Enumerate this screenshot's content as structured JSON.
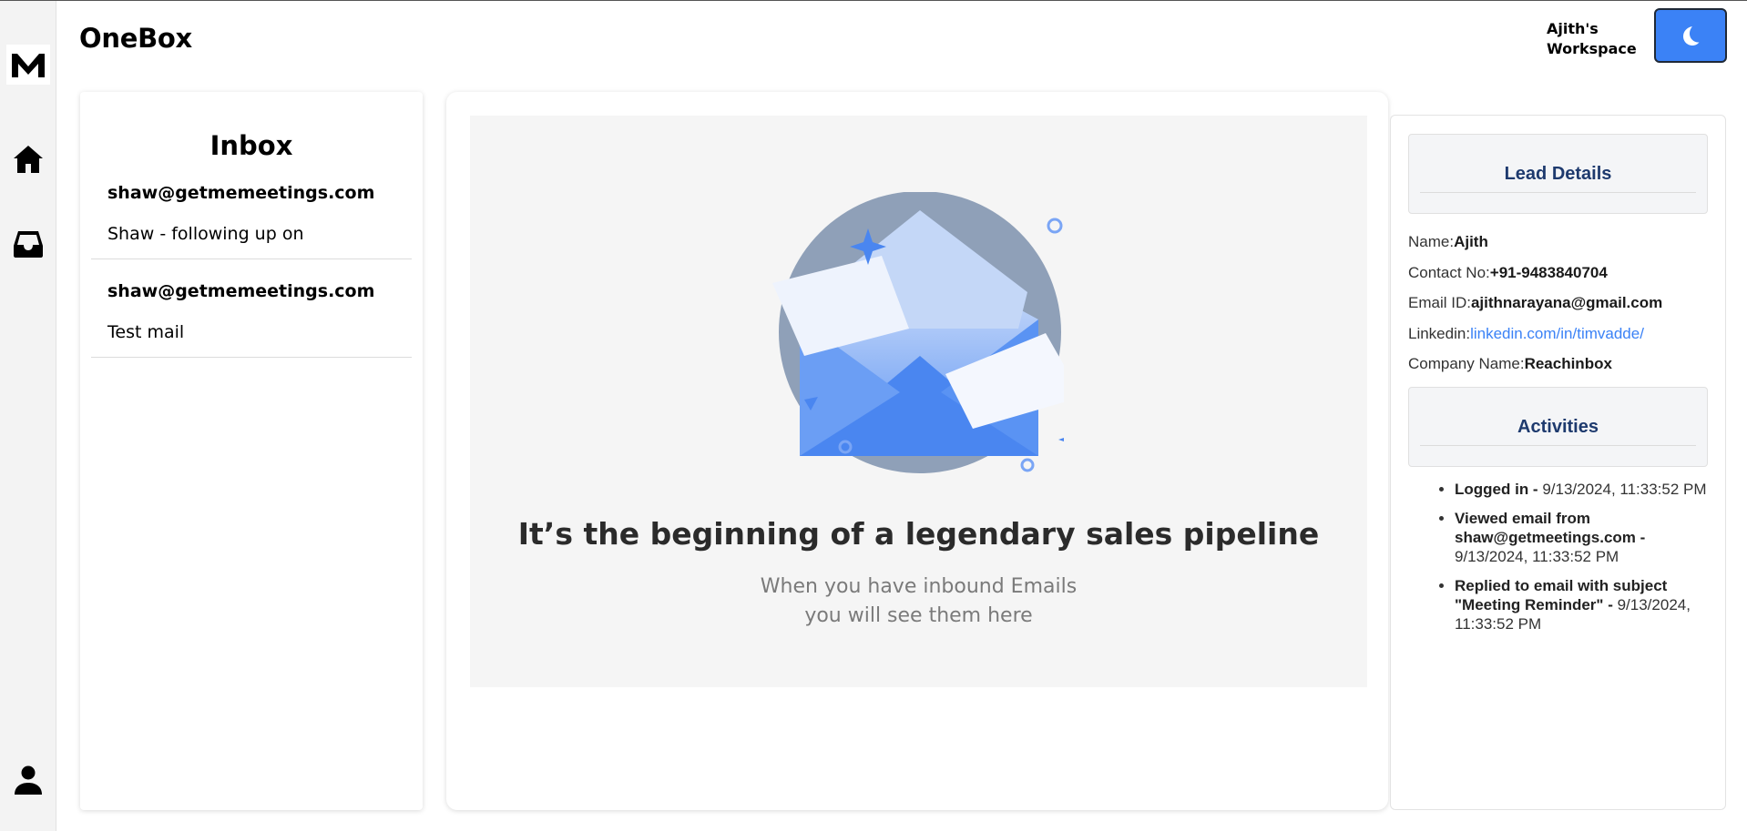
{
  "app": {
    "title": "OneBox",
    "workspace": "Ajith's\nWorkspace"
  },
  "sidebar": {
    "logo": "M",
    "items": [
      {
        "icon": "home-icon"
      },
      {
        "icon": "inbox-icon"
      },
      {
        "icon": "user-icon"
      }
    ]
  },
  "theme_toggle": {
    "icon": "moon-icon"
  },
  "inbox": {
    "title": "Inbox",
    "items": [
      {
        "from": "shaw@getmemeetings.com",
        "subject": "Shaw - following up on"
      },
      {
        "from": "shaw@getmemeetings.com",
        "subject": "Test mail"
      }
    ]
  },
  "empty_state": {
    "title": "It’s the beginning of a legendary sales pipeline",
    "subtitle_line1": "When you have inbound Emails",
    "subtitle_line2": "you will see them here"
  },
  "lead": {
    "heading": "Lead Details",
    "name_label": "Name:",
    "name": "Ajith",
    "contact_label": "Contact No:",
    "contact": "+91-9483840704",
    "email_label": "Email ID:",
    "email": "ajithnarayana@gmail.com",
    "linkedin_label": "Linkedin:",
    "linkedin": "linkedin.com/in/timvadde/",
    "company_label": "Company Name:",
    "company": "Reachinbox"
  },
  "activities": {
    "heading": "Activities",
    "items": [
      {
        "action": "Logged in - ",
        "time": "9/13/2024, 11:33:52 PM"
      },
      {
        "action": "Viewed email from shaw@getmeetings.com - ",
        "time": "9/13/2024, 11:33:52 PM"
      },
      {
        "action": "Replied to email with subject \"Meeting Reminder\" - ",
        "time": "9/13/2024, 11:33:52 PM"
      }
    ]
  },
  "colors": {
    "accent": "#3b82f6",
    "heading_blue": "#1e3a6e",
    "sidebar_bg": "#f3f3f3"
  }
}
